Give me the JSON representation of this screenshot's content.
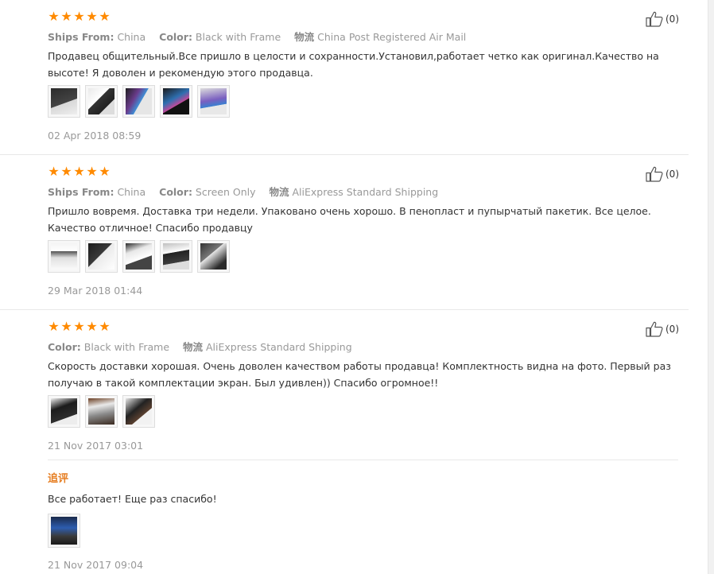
{
  "reviews": [
    {
      "rating": 5,
      "meta": [
        {
          "key": "Ships From:",
          "value": "China"
        },
        {
          "key": "Color:",
          "value": "Black with Frame"
        },
        {
          "key": "物流",
          "value": "China Post Registered Air Mail"
        }
      ],
      "text": "Продавец общительный.Все пришло в целости и сохранности.Установил,работает четко как оригинал.Качество на высоте! Я доволен и рекомендую этого продавца.",
      "thumbnails": [
        "photo-1",
        "photo-2",
        "photo-3",
        "photo-4",
        "photo-5"
      ],
      "date": "02 Apr 2018 08:59",
      "likes": "(0)"
    },
    {
      "rating": 5,
      "meta": [
        {
          "key": "Ships From:",
          "value": "China"
        },
        {
          "key": "Color:",
          "value": "Screen Only"
        },
        {
          "key": "物流",
          "value": "AliExpress Standard Shipping"
        }
      ],
      "text": "Пришло вовремя. Доставка три недели. Упаковано очень хорошо. В пенопласт и пупырчатый пакетик. Все целое. Качество отличное! Спасибо продавцу",
      "thumbnails": [
        "photo-1",
        "photo-2",
        "photo-3",
        "photo-4",
        "photo-5"
      ],
      "date": "29 Mar 2018 01:44",
      "likes": "(0)"
    },
    {
      "rating": 5,
      "meta": [
        {
          "key": "Color:",
          "value": "Black with Frame"
        },
        {
          "key": "物流",
          "value": "AliExpress Standard Shipping"
        }
      ],
      "text": "Скорость доставки хорошая. Очень доволен качеством работы продавца! Комплектность видна на фото. Первый раз получаю в такой комплектации экран. Был удивлен)) Спасибо огромное!!",
      "thumbnails": [
        "photo-1",
        "photo-2",
        "photo-3"
      ],
      "date": "21 Nov 2017 03:01",
      "likes": "(0)",
      "followup": {
        "label": "追评",
        "text": "Все работает! Еще раз спасибо!",
        "thumbnails": [
          "photo-1"
        ],
        "date": "21 Nov 2017 09:04"
      }
    }
  ],
  "colors": {
    "star": "#ff8a00",
    "followup_label": "#e67e22",
    "muted": "#999999"
  },
  "icons": {
    "like": "thumbs-up-icon",
    "star": "star-icon"
  }
}
